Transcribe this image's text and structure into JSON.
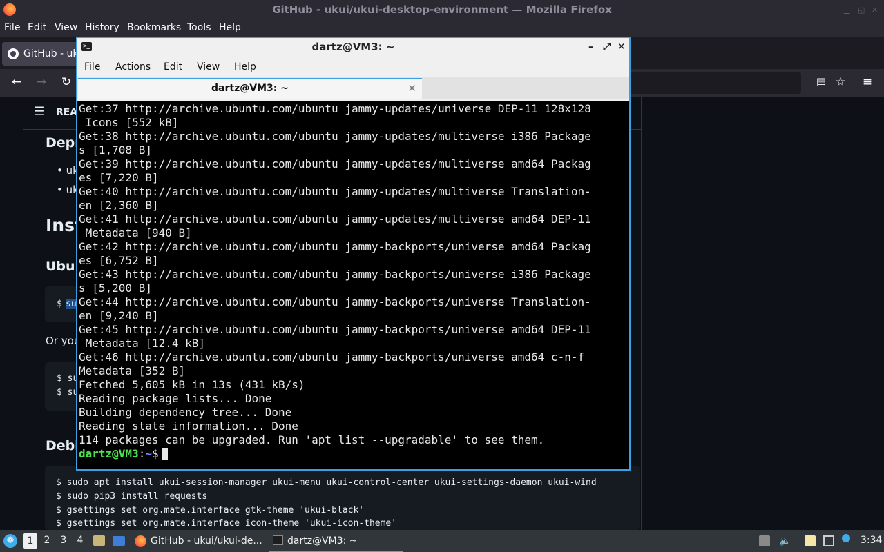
{
  "firefox": {
    "window_title": "GitHub - ukui/ukui-desktop-environment — Mozilla Firefox",
    "menu": [
      "File",
      "Edit",
      "View",
      "History",
      "Bookmarks",
      "Tools",
      "Help"
    ],
    "tab_label": "GitHub - uku"
  },
  "github": {
    "readme_label": "REA",
    "heading_depr": "Depr",
    "bullets": [
      "uk",
      "uk"
    ],
    "heading_install": "Insta",
    "heading_ubuntu": "Ubun",
    "code1_prefix": "$",
    "code1_highlight": "su",
    "or_you": "Or you",
    "code2_lines": [
      "$ su",
      "$ su"
    ],
    "heading_debian": "Debia",
    "code3_lines": [
      "$ sudo apt install ukui-session-manager ukui-menu ukui-control-center ukui-settings-daemon ukui-wind",
      "$ sudo pip3 install requests",
      "$ gsettings set org.mate.interface gtk-theme 'ukui-black'",
      "$ gsettings set org.mate.interface icon-theme 'ukui-icon-theme'"
    ]
  },
  "terminal": {
    "title": "dartz@VM3: ~",
    "menu": [
      "File",
      "Actions",
      "Edit",
      "View",
      "Help"
    ],
    "tab_label": "dartz@VM3: ~",
    "lines": [
      "Get:37 http://archive.ubuntu.com/ubuntu jammy-updates/universe DEP-11 128x128",
      " Icons [552 kB]",
      "Get:38 http://archive.ubuntu.com/ubuntu jammy-updates/multiverse i386 Package",
      "s [1,708 B]",
      "Get:39 http://archive.ubuntu.com/ubuntu jammy-updates/multiverse amd64 Packag",
      "es [7,220 B]",
      "Get:40 http://archive.ubuntu.com/ubuntu jammy-updates/multiverse Translation-",
      "en [2,360 B]",
      "Get:41 http://archive.ubuntu.com/ubuntu jammy-updates/multiverse amd64 DEP-11",
      " Metadata [940 B]",
      "Get:42 http://archive.ubuntu.com/ubuntu jammy-backports/universe amd64 Packag",
      "es [6,752 B]",
      "Get:43 http://archive.ubuntu.com/ubuntu jammy-backports/universe i386 Package",
      "s [5,200 B]",
      "Get:44 http://archive.ubuntu.com/ubuntu jammy-backports/universe Translation-",
      "en [9,240 B]",
      "Get:45 http://archive.ubuntu.com/ubuntu jammy-backports/universe amd64 DEP-11",
      " Metadata [12.4 kB]",
      "Get:46 http://archive.ubuntu.com/ubuntu jammy-backports/universe amd64 c-n-f",
      "Metadata [352 B]",
      "Fetched 5,605 kB in 13s (431 kB/s)",
      "Reading package lists... Done",
      "Building dependency tree... Done",
      "Reading state information... Done",
      "114 packages can be upgraded. Run 'apt list --upgradable' to see them."
    ],
    "prompt_user": "dartz@VM3",
    "prompt_colon": ":",
    "prompt_path": "~",
    "prompt_symbol": "$"
  },
  "taskbar": {
    "workspaces": [
      "1",
      "2",
      "3",
      "4"
    ],
    "tasks": [
      "GitHub - ukui/ukui-de...",
      "dartz@VM3: ~"
    ],
    "clock": "3:34"
  },
  "icons": {
    "start": "start-menu-icon",
    "file_manager": "file-manager-icon",
    "show_desktop": "show-desktop-icon",
    "firefox": "firefox-icon",
    "terminal": "terminal-icon",
    "volume": "volume-icon",
    "clipboard": "clipboard-icon",
    "network": "network-icon",
    "notification": "notification-icon"
  },
  "colors": {
    "accent": "#3aa0e0",
    "prompt_user": "#4ee44e",
    "prompt_path": "#6c8cff"
  }
}
